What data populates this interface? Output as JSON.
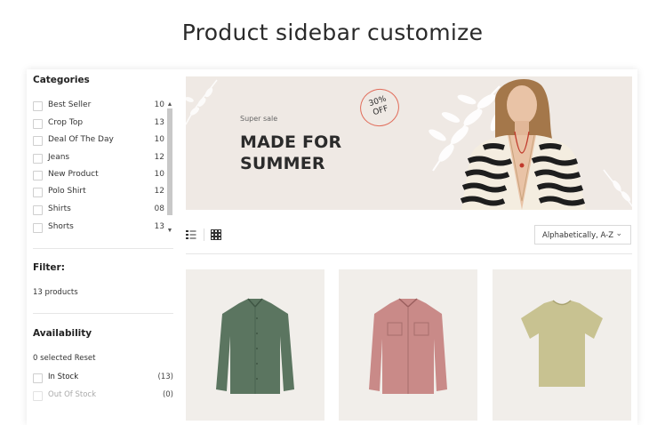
{
  "page": {
    "title": "Product sidebar customize"
  },
  "sidebar": {
    "categories_title": "Categories",
    "categories": [
      {
        "label": "Best Seller",
        "count": "10"
      },
      {
        "label": "Crop Top",
        "count": "13"
      },
      {
        "label": "Deal Of The Day",
        "count": "10"
      },
      {
        "label": "Jeans",
        "count": "12"
      },
      {
        "label": "New Product",
        "count": "10"
      },
      {
        "label": "Polo Shirt",
        "count": "12"
      },
      {
        "label": "Shirts",
        "count": "08"
      },
      {
        "label": "Shorts",
        "count": "13"
      }
    ],
    "filter_title": "Filter:",
    "product_count": "13 products",
    "availability_title": "Availability",
    "selected_text": "0 selected Reset",
    "availability": [
      {
        "label": "In Stock",
        "count": "(13)",
        "disabled": false
      },
      {
        "label": "Out Of Stock",
        "count": "(0)",
        "disabled": true
      }
    ]
  },
  "banner": {
    "super": "Super sale",
    "headline_line1": "MADE FOR",
    "headline_line2": "SUMMER",
    "badge_line1": "30%",
    "badge_line2": "OFF"
  },
  "toolbar": {
    "view_list_icon": "list-view-icon",
    "view_grid_icon": "grid-view-icon",
    "sort_selected": "Alphabetically, A-Z"
  },
  "products": [
    {
      "icon": "green-shirt",
      "color": "#5b7560"
    },
    {
      "icon": "pink-shirt",
      "color": "#c98a88"
    },
    {
      "icon": "khaki-tshirt",
      "color": "#c8c291"
    }
  ],
  "colors": {
    "accent": "#e16c5a",
    "banner_bg": "#efe9e4",
    "card_bg": "#f1eeea"
  }
}
